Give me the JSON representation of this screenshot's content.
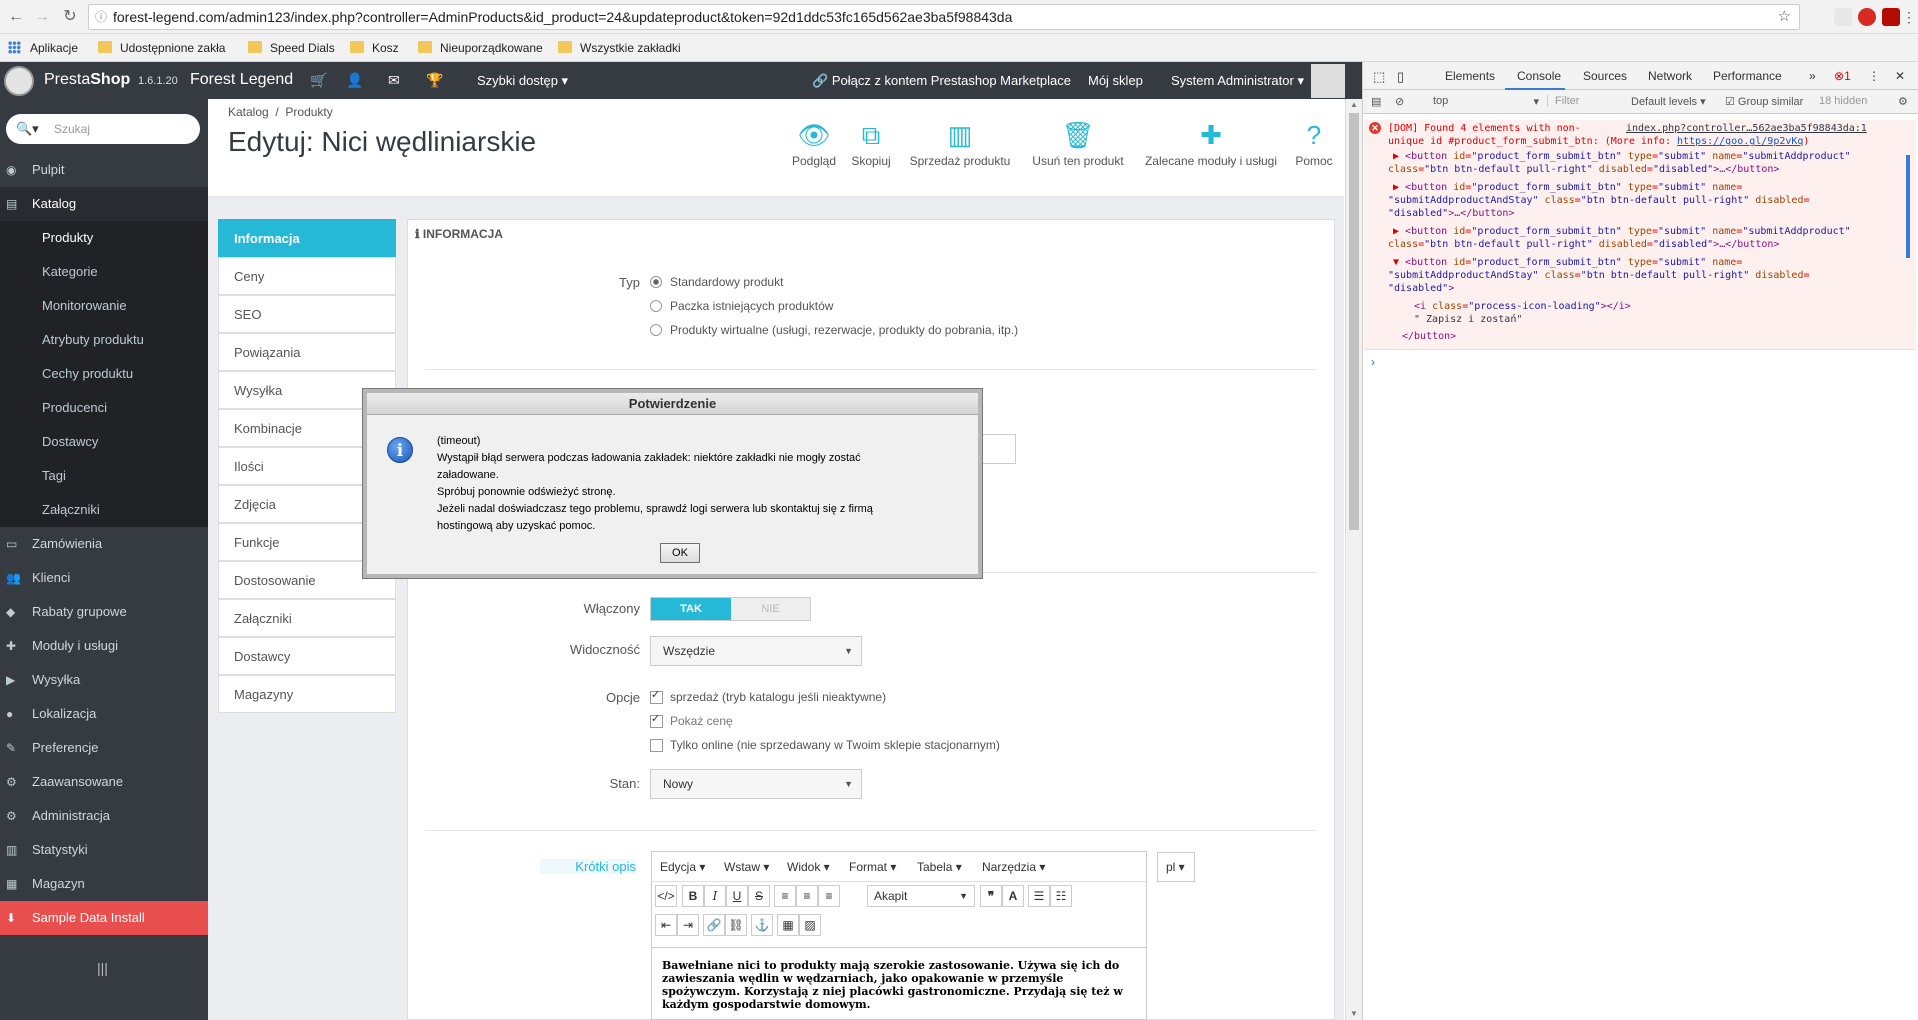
{
  "browser": {
    "url": "forest-legend.com/admin123/index.php?controller=AdminProducts&id_product=24&updateproduct&token=92d1ddc53fc165d562ae3ba5f98843da",
    "bookmarks": [
      "Aplikacje",
      "Udostępnione zakła",
      "Speed Dials",
      "Kosz",
      "Nieuporządkowane",
      "Wszystkie zakładki"
    ]
  },
  "header": {
    "brand_a": "Presta",
    "brand_b": "Shop",
    "version": "1.6.1.20",
    "shop_name": "Forest Legend",
    "quick_access": "Szybki dostęp",
    "marketplace": "Połącz z kontem Prestashop Marketplace",
    "my_shop": "Mój sklep",
    "admin": "System Administrator"
  },
  "sidebar": {
    "search_placeholder": "Szukaj",
    "items": [
      {
        "label": "Pulpit",
        "icon": "dashboard-icon"
      },
      {
        "label": "Katalog",
        "icon": "catalog-icon"
      },
      {
        "label": "Produkty"
      },
      {
        "label": "Kategorie"
      },
      {
        "label": "Monitorowanie"
      },
      {
        "label": "Atrybuty produktu"
      },
      {
        "label": "Cechy produktu"
      },
      {
        "label": "Producenci"
      },
      {
        "label": "Dostawcy"
      },
      {
        "label": "Tagi"
      },
      {
        "label": "Załączniki"
      },
      {
        "label": "Zamówienia",
        "icon": "orders-icon"
      },
      {
        "label": "Klienci",
        "icon": "customers-icon"
      },
      {
        "label": "Rabaty grupowe",
        "icon": "discount-icon"
      },
      {
        "label": "Moduły i usługi",
        "icon": "modules-icon"
      },
      {
        "label": "Wysyłka",
        "icon": "shipping-icon"
      },
      {
        "label": "Lokalizacja",
        "icon": "localization-icon"
      },
      {
        "label": "Preferencje",
        "icon": "preferences-icon"
      },
      {
        "label": "Zaawansowane",
        "icon": "advanced-icon"
      },
      {
        "label": "Administracja",
        "icon": "administration-icon"
      },
      {
        "label": "Statystyki",
        "icon": "stats-icon"
      },
      {
        "label": "Magazyn",
        "icon": "stock-icon"
      },
      {
        "label": "Sample Data Install",
        "icon": "download-icon"
      }
    ]
  },
  "page": {
    "breadcrumb_1": "Katalog",
    "breadcrumb_sep": "/",
    "breadcrumb_2": "Produkty",
    "title": "Edytuj: Nici wędliniarskie",
    "toolbar": [
      "Podgląd",
      "Skopiuj",
      "Sprzedaż produktu",
      "Usuń ten produkt",
      "Zalecane moduły i usługi",
      "Pomoc"
    ]
  },
  "tabs": [
    "Informacja",
    "Ceny",
    "SEO",
    "Powiązania",
    "Wysyłka",
    "Kombinacje",
    "Ilości",
    "Zdjęcia",
    "Funkcje",
    "Dostosowanie",
    "Załączniki",
    "Dostawcy",
    "Magazyny"
  ],
  "form": {
    "panel_title": "INFORMACJA",
    "type_label": "Typ",
    "type_options": [
      "Standardowy produkt",
      "Paczka istniejących produktów",
      "Produkty wirtualne (usługi, rezerwacje, produkty do pobrania, itp.)"
    ],
    "enabled_label": "Włączony",
    "yes": "TAK",
    "no": "NIE",
    "visibility_label": "Widoczność",
    "visibility_value": "Wszędzie",
    "options_label": "Opcje",
    "options": [
      "sprzedaż (tryb katalogu jeśli nieaktywne)",
      "Pokaż cenę",
      "Tylko online (nie sprzedawany w Twoim sklepie stacjonarnym)"
    ],
    "condition_label": "Stan:",
    "condition_value": "Nowy",
    "short_desc_label": "Krótki opis",
    "lang": "pl",
    "editor_menu": [
      "Edycja",
      "Wstaw",
      "Widok",
      "Format",
      "Tabela",
      "Narzędzia"
    ],
    "editor_format": "Akapit",
    "short_desc_text": "Bawełniane nici to produkty mają szerokie zastosowanie. Używa się ich do zawieszania wędlin w wędzarniach, jako opakowanie w przemyśle spożywczym. Korzystają z niej placówki gastronomiczne. Przydają się też w każdym gospodarstwie domowym."
  },
  "modal": {
    "title": "Potwierdzenie",
    "line1": "(timeout)",
    "line2": "Wystąpił błąd serwera podczas ładowania zakładek: niektóre zakładki nie mogły zostać",
    "line3": "załadowane.",
    "line4": "Spróbuj ponownie odświeżyć stronę.",
    "line5": "Jeżeli nadal doświadczasz tego problemu, sprawdź logi serwera lub skontaktuj się z firmą",
    "line6": "hostingową aby uzyskać pomoc.",
    "ok": "OK"
  },
  "devtools": {
    "tabs": [
      "Elements",
      "Console",
      "Sources",
      "Network",
      "Performance"
    ],
    "error_count": "1",
    "context": "top",
    "filter": "Filter",
    "levels": "Default levels",
    "group_similar": "Group similar",
    "hidden": "18 hidden",
    "err_line1": "[DOM] Found 4 elements with non-",
    "err_source": "index.php?controller…562ae3ba5f98843da:1",
    "err_line2": "unique id #product_form_submit_btn: (More info: ",
    "err_link": "https://goo.gl/9p2vKq",
    "err_line2_end": ")",
    "zapisz": "\" Zapisz i zostań\""
  },
  "colors": {
    "accent": "#25b9d7",
    "sidebar": "#363a41",
    "danger": "#e84e4e"
  }
}
